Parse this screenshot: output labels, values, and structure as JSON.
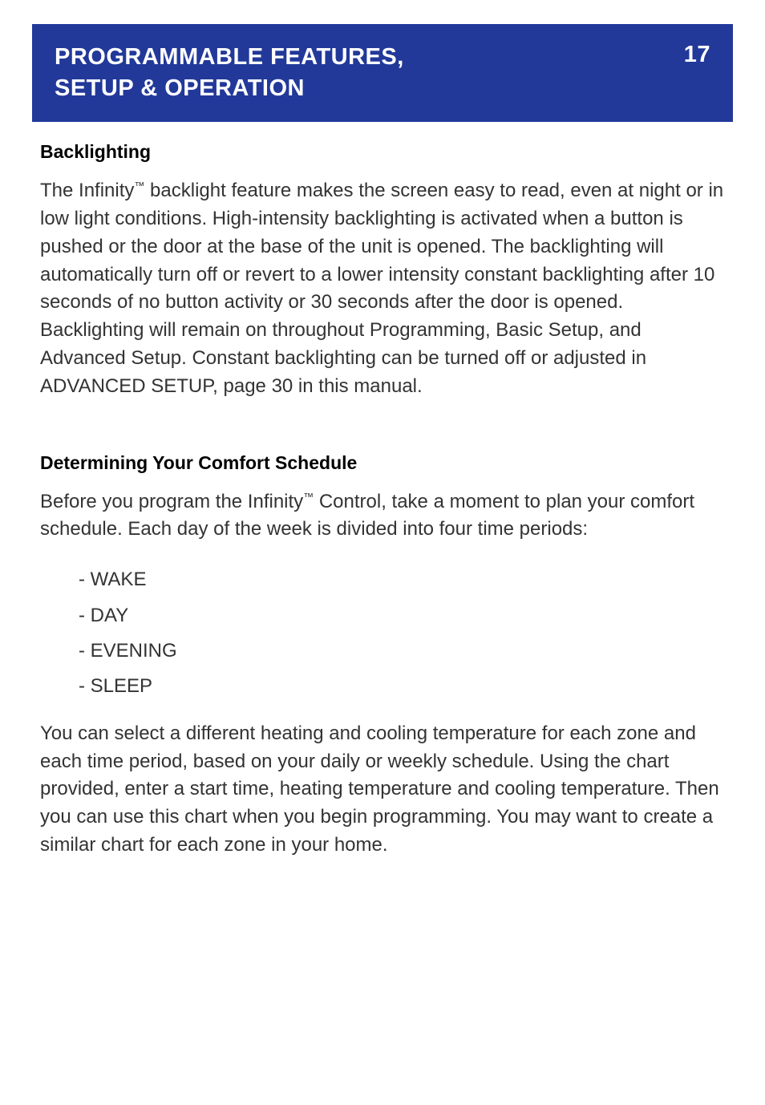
{
  "header": {
    "title_line1": "PROGRAMMABLE FEATURES,",
    "title_line2": "SETUP & OPERATION",
    "page_number": "17"
  },
  "sections": {
    "backlighting": {
      "heading": "Backlighting",
      "para_before_tm": "The Infinity",
      "tm": "™",
      "para_after_tm": " backlight feature makes the screen easy to read, even at night or in low light conditions. High-intensity backlighting is activated when a button is pushed or the door at the base of the unit is opened. The backlighting will automatically turn off or revert to a lower intensity constant backlighting after 10 seconds of no button activity or 30 seconds after the door is opened. Backlighting will remain on throughout Programming, Basic Setup, and Advanced Setup. Constant backlighting can be turned off or adjusted in ADVANCED SETUP, page 30 in this manual."
    },
    "schedule": {
      "heading": "Determining Your Comfort Schedule",
      "intro_before_tm": "Before you program the Infinity",
      "tm": "™",
      "intro_after_tm": " Control, take a moment to plan your comfort schedule. Each day of the week is divided into four time periods:",
      "items": [
        "- WAKE",
        "- DAY",
        "- EVENING",
        "- SLEEP"
      ],
      "outro": "You can select a different heating and cooling temperature for each zone and each time period, based on your daily or weekly schedule. Using the chart provided, enter a start time, heating temperature and cooling temperature. Then you can use this chart when you begin programming. You may want to create a similar chart for each zone in your home."
    }
  }
}
